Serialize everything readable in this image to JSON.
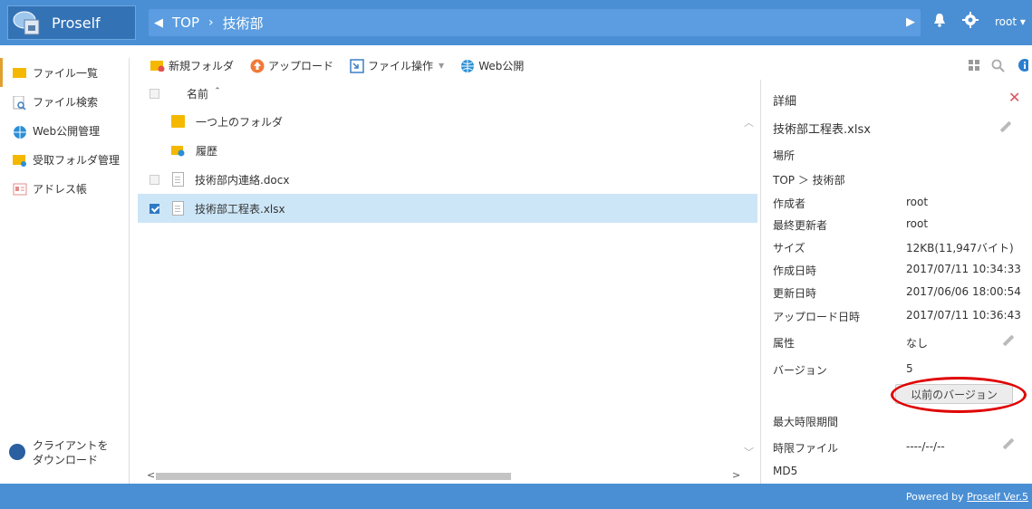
{
  "app": {
    "title": "Proself"
  },
  "breadcrumb": {
    "root": "TOP",
    "sep": "›",
    "current": "技術部"
  },
  "header": {
    "user": "root ▾"
  },
  "sidebar": {
    "items": [
      {
        "label": "ファイル一覧",
        "icon": "folder-icon"
      },
      {
        "label": "ファイル検索",
        "icon": "file-search-icon"
      },
      {
        "label": "Web公開管理",
        "icon": "web-publish-icon"
      },
      {
        "label": "受取フォルダ管理",
        "icon": "receive-folder-icon"
      },
      {
        "label": "アドレス帳",
        "icon": "address-book-icon"
      }
    ],
    "download_line1": "クライアントを",
    "download_line2": "ダウンロード"
  },
  "toolbar": {
    "new_folder": "新規フォルダ",
    "upload": "アップロード",
    "file_ops": "ファイル操作",
    "file_ops_caret": "▼",
    "web_publish": "Web公開"
  },
  "list": {
    "header_name": "名前 ＾",
    "rows": [
      {
        "name": "一つ上のフォルダ",
        "type": "folder",
        "checkbox": false
      },
      {
        "name": "履歴",
        "type": "history-folder",
        "checkbox": false
      },
      {
        "name": "技術部内連絡.docx",
        "type": "doc",
        "checkbox": true,
        "checked": false
      },
      {
        "name": "技術部工程表.xlsx",
        "type": "doc",
        "checkbox": true,
        "checked": true
      }
    ]
  },
  "details": {
    "title": "詳細",
    "file_name": "技術部工程表.xlsx",
    "location_label": "場所",
    "location_value": "TOP ＞ 技術部",
    "creator_label": "作成者",
    "creator_value": "root",
    "updater_label": "最終更新者",
    "updater_value": "root",
    "size_label": "サイズ",
    "size_value": "12KB(11,947バイト)",
    "created_label": "作成日時",
    "created_value": "2017/07/11 10:34:33",
    "updated_label": "更新日時",
    "updated_value": "2017/06/06 18:00:54",
    "uploaded_label": "アップロード日時",
    "uploaded_value": "2017/07/11 10:36:43",
    "attr_label": "属性",
    "attr_value": "なし",
    "version_label": "バージョン",
    "version_value": "5",
    "prev_version_button": "以前のバージョン",
    "max_period_label": "最大時限期間",
    "timed_file_label": "時限ファイル",
    "timed_file_value": "----/--/--",
    "md5_label": "MD5"
  },
  "footer": {
    "prefix": "Powered by ",
    "link": "Proself Ver.5"
  },
  "colors": {
    "header": "#4a8fd4",
    "selected_row": "#cde6f7",
    "highlight_ring": "#e00000",
    "close": "#e0505a"
  }
}
